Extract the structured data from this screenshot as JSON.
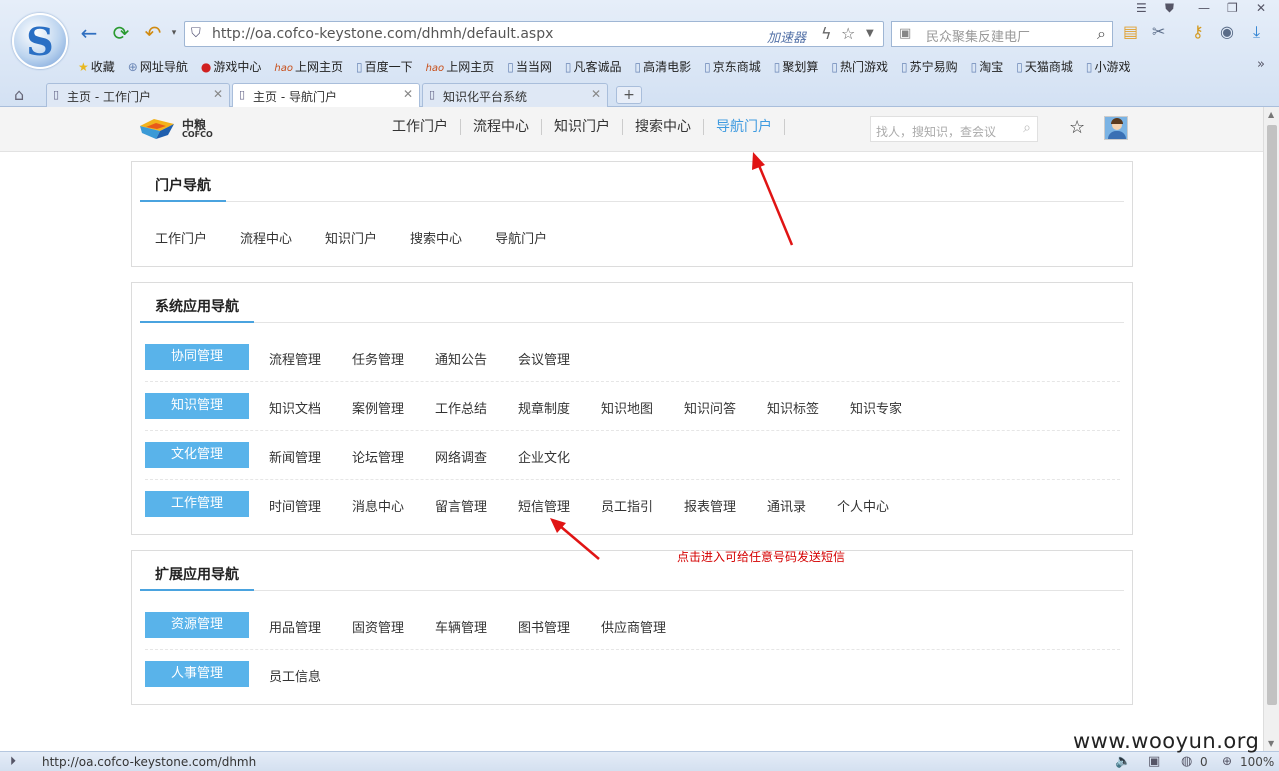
{
  "browser": {
    "address_url": "http://oa.cofco-keystone.com/dhmh/default.aspx",
    "accelerator_label": "加速器",
    "search_placeholder": "民众聚集反建电厂",
    "bookmarks": [
      "收藏",
      "网址导航",
      "游戏中心",
      "上网主页",
      "百度一下",
      "上网主页",
      "当当网",
      "凡客诚品",
      "高清电影",
      "京东商城",
      "聚划算",
      "热门游戏",
      "苏宁易购",
      "淘宝",
      "天猫商城",
      "小游戏"
    ],
    "more_symbol": "»",
    "tabs": [
      {
        "label": "主页 - 工作门户",
        "active": false
      },
      {
        "label": "主页 - 导航门户",
        "active": true
      },
      {
        "label": "知识化平台系统",
        "active": false
      }
    ],
    "new_tab_symbol": "+",
    "status_url": "http://oa.cofco-keystone.com/dhmh",
    "status_count": "0",
    "zoom": "100%"
  },
  "site": {
    "brand_cn": "中粮",
    "brand_en": "COFCO",
    "nav": [
      {
        "label": "工作门户",
        "active": false
      },
      {
        "label": "流程中心",
        "active": false
      },
      {
        "label": "知识门户",
        "active": false
      },
      {
        "label": "搜索中心",
        "active": false
      },
      {
        "label": "导航门户",
        "active": true
      }
    ],
    "search_placeholder": "找人，搜知识，查会议"
  },
  "portal_nav": {
    "title": "门户导航",
    "links": [
      "工作门户",
      "流程中心",
      "知识门户",
      "搜索中心",
      "导航门户"
    ]
  },
  "system_nav": {
    "title": "系统应用导航",
    "rows": [
      {
        "category": "协同管理",
        "items": [
          "流程管理",
          "任务管理",
          "通知公告",
          "会议管理"
        ]
      },
      {
        "category": "知识管理",
        "items": [
          "知识文档",
          "案例管理",
          "工作总结",
          "规章制度",
          "知识地图",
          "知识问答",
          "知识标签",
          "知识专家"
        ]
      },
      {
        "category": "文化管理",
        "items": [
          "新闻管理",
          "论坛管理",
          "网络调查",
          "企业文化"
        ]
      },
      {
        "category": "工作管理",
        "items": [
          "时间管理",
          "消息中心",
          "留言管理",
          "短信管理",
          "员工指引",
          "报表管理",
          "通讯录",
          "个人中心"
        ]
      }
    ]
  },
  "ext_nav": {
    "title": "扩展应用导航",
    "rows": [
      {
        "category": "资源管理",
        "items": [
          "用品管理",
          "固资管理",
          "车辆管理",
          "图书管理",
          "供应商管理"
        ]
      },
      {
        "category": "人事管理",
        "items": [
          "员工信息"
        ]
      }
    ]
  },
  "annotation_text": "点击进入可给任意号码发送短信",
  "watermark": "www.wooyun.org",
  "colors": {
    "accent": "#59b3ea",
    "active_nav": "#3f9be0",
    "annotation": "#d40000"
  }
}
